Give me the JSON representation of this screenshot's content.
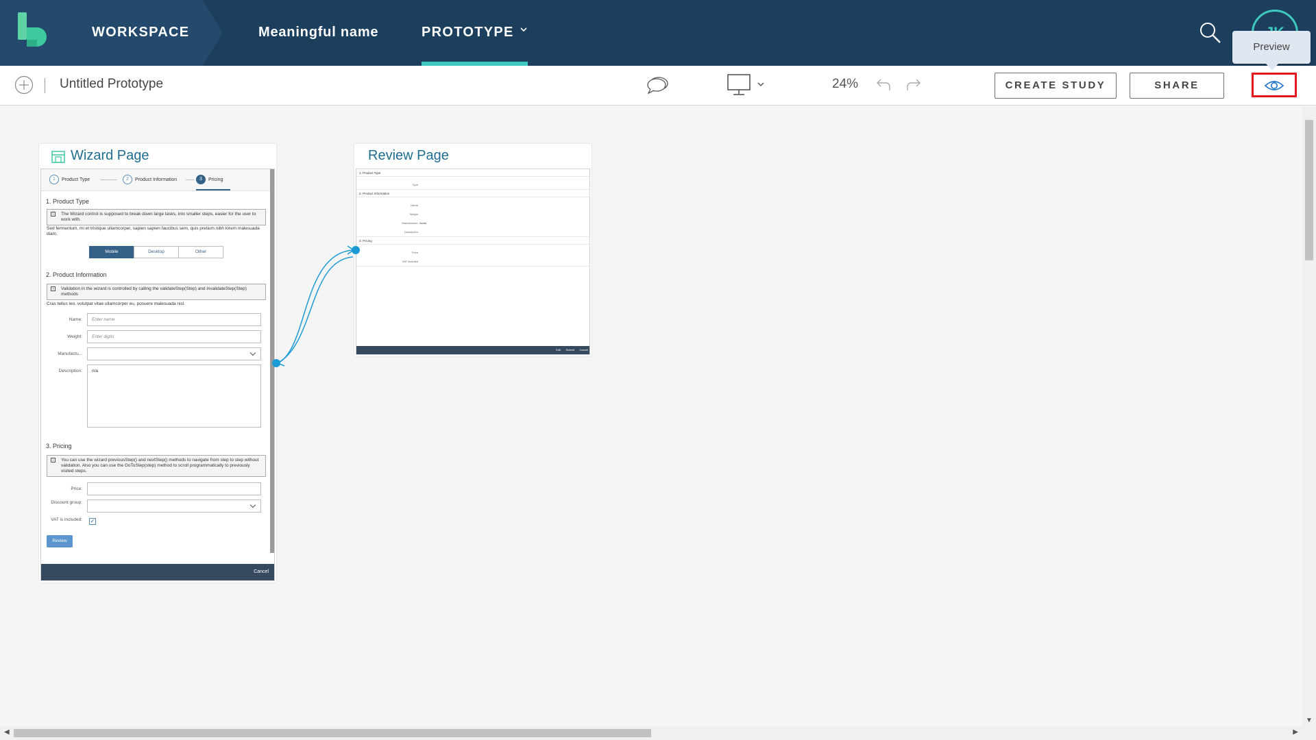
{
  "topbar": {
    "workspace": "WORKSPACE",
    "project_name": "Meaningful name",
    "prototype": "PROTOTYPE",
    "avatar_initials": "JK",
    "accent_color": "#3ec9c1",
    "bg_color": "#1d3f5e"
  },
  "toolbar": {
    "prototype_title": "Untitled Prototype",
    "zoom": "24%",
    "create_study": "CREATE STUDY",
    "share": "SHARE",
    "preview_tooltip": "Preview",
    "highlight_color": "#e3161d"
  },
  "pages": {
    "wizard": {
      "title": "Wizard Page",
      "steps": [
        "Product Type",
        "Product Information",
        "Pricing"
      ],
      "section1": {
        "title": "1. Product Type",
        "info": "The Wizard control is supposed to break down large tasks, into smaller steps, easier for the user to work with.",
        "text": "Sed fermentum, mi et tristique ullamcorper, sapien sapien faucibus sem, quis pretium nibh lorem malesuada diam.",
        "segments": [
          "Mobile",
          "Desktop",
          "Other"
        ],
        "selected_segment": "Mobile"
      },
      "section2": {
        "title": "2. Product Information",
        "info": "Validation in the wizard is controlled by calling the validateStep(Step) and invalidateStep(Step) methods",
        "text": "Cras tellus leo, volutpat vitae ullamcorper eu, posuere malesuada nisl.",
        "name_label": "Name:",
        "name_placeholder": "Enter name",
        "weight_label": "Weight:",
        "weight_placeholder": "Enter digits",
        "manufacturer_label": "Manufactu...",
        "description_label": "Description:",
        "description_value": "n/a"
      },
      "section3": {
        "title": "3. Pricing",
        "info": "You can use the wizard previousStep() and nextStep() methods to navigate from step to step without validation. Also you can use the GoToStep(step) method to scroll programmatically to previously visited steps.",
        "price_label": "Price:",
        "discount_label": "Discount group:",
        "vat_label": "VAT is included:",
        "vat_checked": true,
        "review_button": "Review"
      },
      "footer_cancel": "Cancel"
    },
    "review": {
      "title": "Review Page",
      "sections": [
        "1. Product Type",
        "2. Product Information",
        "3. Pricing"
      ],
      "fields": [
        "Type",
        "Name",
        "Weight",
        "Manufacturer",
        "Description",
        "Price",
        "VAT included"
      ],
      "manufacturer_value": "Acme",
      "footer_buttons": [
        "Edit",
        "Submit",
        "Cancel"
      ]
    }
  }
}
